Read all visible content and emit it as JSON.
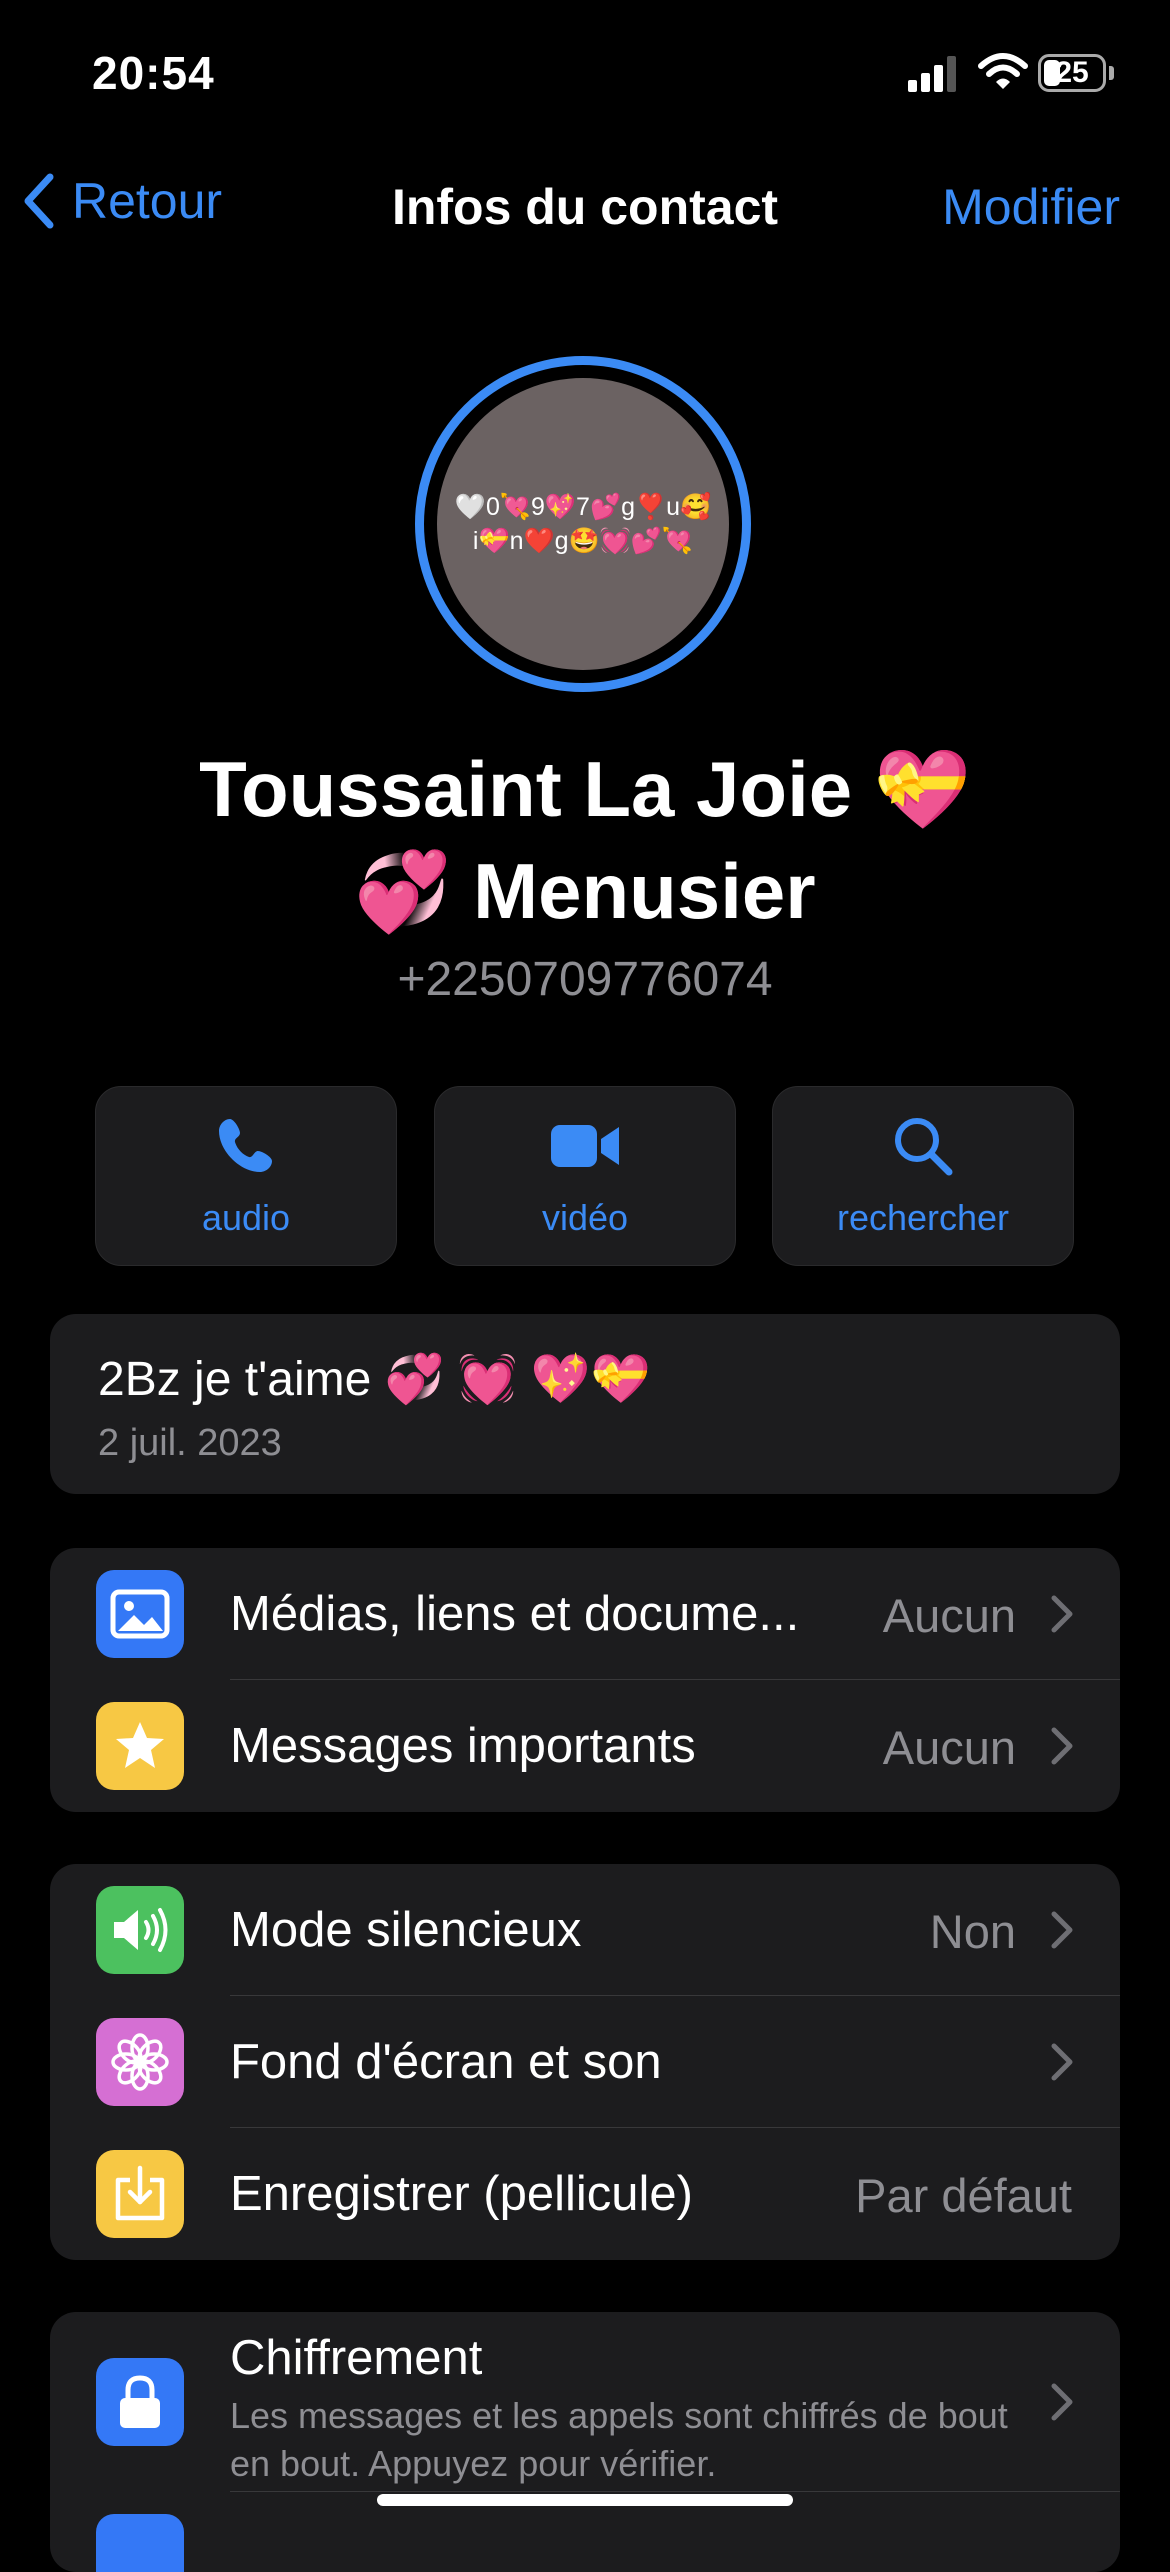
{
  "status_bar": {
    "time": "20:54",
    "battery": "25",
    "battery_level_percent": 25
  },
  "nav": {
    "back_label": "Retour",
    "title": "Infos du contact",
    "edit_label": "Modifier"
  },
  "profile": {
    "avatar_text": "🤍0💘9💖7💕g❣️u🥰i💝n❤️g🤩💓💕💘",
    "name_line1": "Toussaint La Joie 💝",
    "name_line2": "💞 Menusier",
    "phone": "+2250709776074"
  },
  "actions": [
    {
      "label": "audio",
      "icon": "phone-icon"
    },
    {
      "label": "vidéo",
      "icon": "video-icon"
    },
    {
      "label": "rechercher",
      "icon": "search-icon"
    }
  ],
  "about": {
    "status": "2Bz je t'aime 💞 💓 💖💝",
    "date": "2 juil. 2023"
  },
  "group1": [
    {
      "label": "Médias, liens et docume...",
      "value": "Aucun",
      "icon": "photo-icon",
      "color": "#3478f6"
    },
    {
      "label": "Messages importants",
      "value": "Aucun",
      "icon": "star-icon",
      "color": "#f7c844"
    }
  ],
  "group2": [
    {
      "label": "Mode silencieux",
      "value": "Non",
      "icon": "speaker-icon",
      "color": "#4cc15f"
    },
    {
      "label": "Fond d'écran et son",
      "value": "",
      "icon": "flower-icon",
      "color": "#d56fd3"
    },
    {
      "label": "Enregistrer (pellicule)",
      "value": "Par défaut",
      "icon": "download-icon",
      "color": "#f7c844"
    }
  ],
  "group3": [
    {
      "label": "Chiffrement",
      "subtitle": "Les messages et les appels sont chiffrés de bout en bout. Appuyez pour vérifier.",
      "icon": "lock-icon",
      "color": "#3478f6"
    }
  ],
  "colors": {
    "accent": "#3b8bf5",
    "background": "#000000",
    "card": "#1c1c1e",
    "secondary_text": "#8e8e93"
  }
}
